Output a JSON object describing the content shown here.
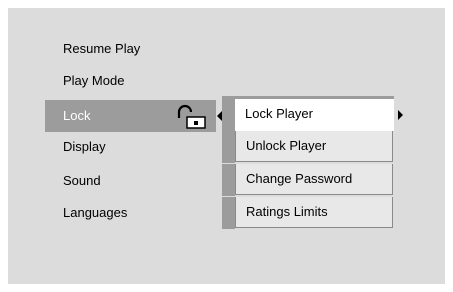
{
  "menu": {
    "items": [
      {
        "label": "Resume Play"
      },
      {
        "label": "Play Mode"
      },
      {
        "label": "Lock",
        "selected": true
      },
      {
        "label": "Display"
      },
      {
        "label": "Sound"
      },
      {
        "label": "Languages"
      }
    ]
  },
  "submenu": {
    "items": [
      {
        "label": "Lock Player",
        "selected": true
      },
      {
        "label": "Unlock Player"
      },
      {
        "label": "Change Password"
      },
      {
        "label": "Ratings Limits"
      }
    ]
  },
  "icons": {
    "lock": "unlocked-padlock-icon",
    "open_submenu": "arrow-left-icon",
    "item_has_submenu": "arrow-right-icon"
  },
  "colors": {
    "screen_background": "#dcdcdc",
    "highlight": "#9c9c9c",
    "selected_label": "#ffffff",
    "submenu_item_background": "#e8e8e8",
    "submenu_selected_background": "#ffffff"
  }
}
